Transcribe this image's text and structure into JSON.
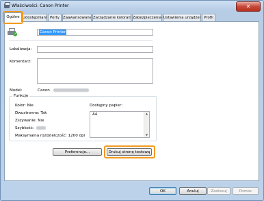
{
  "window": {
    "title": "Właściwości: Canon Printer",
    "close_glyph": "✕"
  },
  "tabs": [
    {
      "label": "Ogólne",
      "active": true
    },
    {
      "label": "Udostępnianie",
      "active": false
    },
    {
      "label": "Porty",
      "active": false
    },
    {
      "label": "Zaawansowane",
      "active": false
    },
    {
      "label": "Zarządzanie kolorami",
      "active": false
    },
    {
      "label": "Zabezpieczenia",
      "active": false
    },
    {
      "label": "Ustawienia urządzenia",
      "active": false
    },
    {
      "label": "Profil",
      "active": false
    }
  ],
  "general": {
    "printer_name": "Canon Printer",
    "location_label": "Lokalizacja:",
    "location_value": "",
    "comment_label": "Komentarz:",
    "comment_value": "",
    "model_label": "Model:",
    "model_value": "Canon"
  },
  "features": {
    "title": "Funkcje",
    "color": "Kolor: Nie",
    "duplex": "Dwustronne: Tak",
    "staple": "Zszywanie: Nie",
    "speed_label": "Szybkość:",
    "max_resolution": "Maksymalna rozdzielczość: 1200 dpi",
    "paper_available_label": "Dostępny papier:",
    "paper_list": [
      "A4"
    ]
  },
  "buttons": {
    "preferences": "Preferencje...",
    "print_test_page": "Drukuj stronę testową",
    "ok": "OK",
    "cancel": "Anuluj",
    "apply": "Zastosuj",
    "help": "Pomoc"
  },
  "colors": {
    "highlight": "#f29a1f",
    "selection": "#3399ff",
    "titlebar_bg": "#c4d9ef",
    "close_button": "#c7493a"
  },
  "icons": {
    "app": "printer-icon",
    "printer": "printer-ready-icon",
    "close": "close-icon",
    "scroll_up": "chevron-up-icon",
    "scroll_down": "chevron-down-icon"
  }
}
